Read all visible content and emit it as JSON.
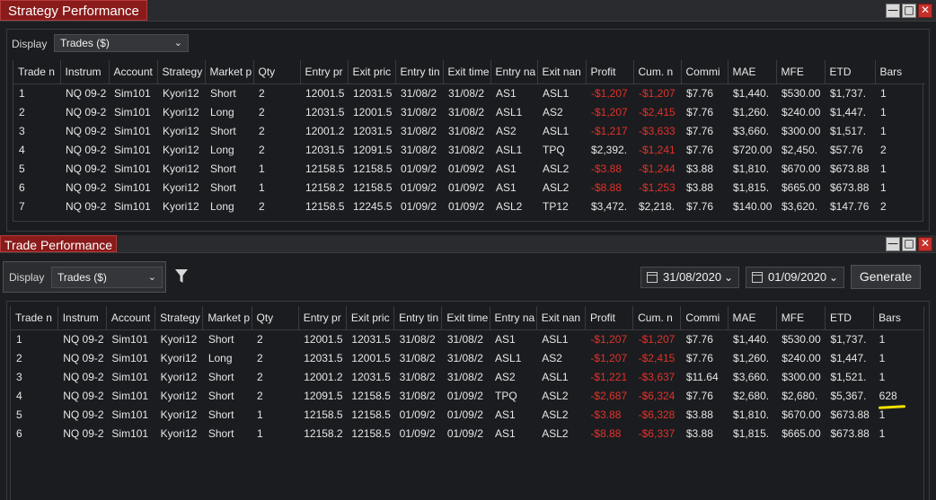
{
  "strategy_panel": {
    "title": "Strategy Performance",
    "display_label": "Display",
    "display_value": "Trades ($)",
    "columns": [
      "Trade n",
      "Instrum",
      "Account",
      "Strategy",
      "Market p",
      "Qty",
      "Entry pr",
      "Exit pric",
      "Entry tin",
      "Exit time",
      "Entry na",
      "Exit nan",
      "Profit",
      "Cum. n",
      "Commi",
      "MAE",
      "MFE",
      "ETD",
      "Bars"
    ],
    "rows": [
      [
        "1",
        "NQ 09-2",
        "Sim101",
        "Kyori12",
        "Short",
        "2",
        "12001.5",
        "12031.5",
        "31/08/2",
        "31/08/2",
        "AS1",
        "ASL1",
        "-$1,207",
        "-$1,207",
        "$7.76",
        "$1,440.",
        "$530.00",
        "$1,737.",
        "1"
      ],
      [
        "2",
        "NQ 09-2",
        "Sim101",
        "Kyori12",
        "Long",
        "2",
        "12031.5",
        "12001.5",
        "31/08/2",
        "31/08/2",
        "ASL1",
        "AS2",
        "-$1,207",
        "-$2,415",
        "$7.76",
        "$1,260.",
        "$240.00",
        "$1,447.",
        "1"
      ],
      [
        "3",
        "NQ 09-2",
        "Sim101",
        "Kyori12",
        "Short",
        "2",
        "12001.2",
        "12031.5",
        "31/08/2",
        "31/08/2",
        "AS2",
        "ASL1",
        "-$1,217",
        "-$3,633",
        "$7.76",
        "$3,660.",
        "$300.00",
        "$1,517.",
        "1"
      ],
      [
        "4",
        "NQ 09-2",
        "Sim101",
        "Kyori12",
        "Long",
        "2",
        "12031.5",
        "12091.5",
        "31/08/2",
        "31/08/2",
        "ASL1",
        "TPQ",
        "$2,392.",
        "-$1,241",
        "$7.76",
        "$720.00",
        "$2,450.",
        "$57.76",
        "2"
      ],
      [
        "5",
        "NQ 09-2",
        "Sim101",
        "Kyori12",
        "Short",
        "1",
        "12158.5",
        "12158.5",
        "01/09/2",
        "01/09/2",
        "AS1",
        "ASL2",
        "-$3.88",
        "-$1,244",
        "$3.88",
        "$1,810.",
        "$670.00",
        "$673.88",
        "1"
      ],
      [
        "6",
        "NQ 09-2",
        "Sim101",
        "Kyori12",
        "Short",
        "1",
        "12158.2",
        "12158.5",
        "01/09/2",
        "01/09/2",
        "AS1",
        "ASL2",
        "-$8.88",
        "-$1,253",
        "$3.88",
        "$1,815.",
        "$665.00",
        "$673.88",
        "1"
      ],
      [
        "7",
        "NQ 09-2",
        "Sim101",
        "Kyori12",
        "Long",
        "2",
        "12158.5",
        "12245.5",
        "01/09/2",
        "01/09/2",
        "ASL2",
        "TP12",
        "$3,472.",
        "$2,218.",
        "$7.76",
        "$140.00",
        "$3,620.",
        "$147.76",
        "2"
      ]
    ]
  },
  "trade_panel": {
    "title": "Trade Performance",
    "display_label": "Display",
    "display_value": "Trades ($)",
    "filter_icon": "filter-icon",
    "date_from": "31/08/2020",
    "date_to": "01/09/2020",
    "generate_label": "Generate",
    "columns": [
      "Trade n",
      "Instrum",
      "Account",
      "Strategy",
      "Market p",
      "Qty",
      "Entry pr",
      "Exit pric",
      "Entry tin",
      "Exit time",
      "Entry na",
      "Exit nan",
      "Profit",
      "Cum. n",
      "Commi",
      "MAE",
      "MFE",
      "ETD",
      "Bars"
    ],
    "rows": [
      [
        "1",
        "NQ 09-2",
        "Sim101",
        "Kyori12",
        "Short",
        "2",
        "12001.5",
        "12031.5",
        "31/08/2",
        "31/08/2",
        "AS1",
        "ASL1",
        "-$1,207",
        "-$1,207",
        "$7.76",
        "$1,440.",
        "$530.00",
        "$1,737.",
        "1"
      ],
      [
        "2",
        "NQ 09-2",
        "Sim101",
        "Kyori12",
        "Long",
        "2",
        "12031.5",
        "12001.5",
        "31/08/2",
        "31/08/2",
        "ASL1",
        "AS2",
        "-$1,207",
        "-$2,415",
        "$7.76",
        "$1,260.",
        "$240.00",
        "$1,447.",
        "1"
      ],
      [
        "3",
        "NQ 09-2",
        "Sim101",
        "Kyori12",
        "Short",
        "2",
        "12001.2",
        "12031.5",
        "31/08/2",
        "31/08/2",
        "AS2",
        "ASL1",
        "-$1,221",
        "-$3,637",
        "$11.64",
        "$3,660.",
        "$300.00",
        "$1,521.",
        "1"
      ],
      [
        "4",
        "NQ 09-2",
        "Sim101",
        "Kyori12",
        "Short",
        "2",
        "12091.5",
        "12158.5",
        "31/08/2",
        "01/09/2",
        "TPQ",
        "ASL2",
        "-$2,687",
        "-$6,324",
        "$7.76",
        "$2,680.",
        "$2,680.",
        "$5,367.",
        "628"
      ],
      [
        "5",
        "NQ 09-2",
        "Sim101",
        "Kyori12",
        "Short",
        "1",
        "12158.5",
        "12158.5",
        "01/09/2",
        "01/09/2",
        "AS1",
        "ASL2",
        "-$3.88",
        "-$6,328",
        "$3.88",
        "$1,810.",
        "$670.00",
        "$673.88",
        "1"
      ],
      [
        "6",
        "NQ 09-2",
        "Sim101",
        "Kyori12",
        "Short",
        "1",
        "12158.2",
        "12158.5",
        "01/09/2",
        "01/09/2",
        "AS1",
        "ASL2",
        "-$8.88",
        "-$6,337",
        "$3.88",
        "$1,815.",
        "$665.00",
        "$673.88",
        "1"
      ]
    ]
  },
  "colors": {
    "negative": "#e0322b",
    "title_tab": "#8a1b1b",
    "highlight": "#f0e000"
  }
}
